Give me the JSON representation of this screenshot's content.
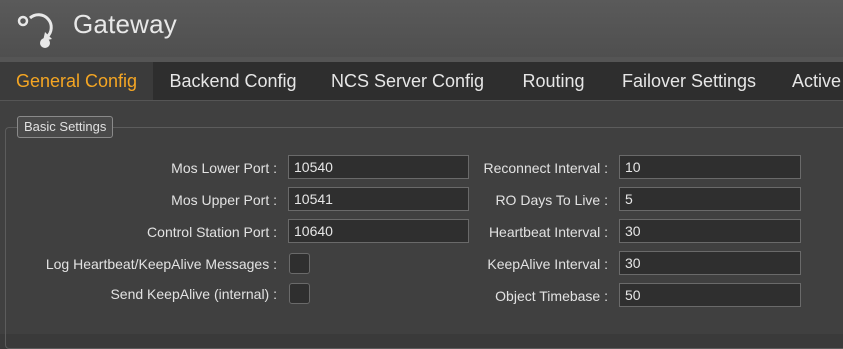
{
  "app": {
    "title": "Gateway",
    "logo_icon": "gateway-logo-icon"
  },
  "tabs": [
    {
      "label": "General Config",
      "active": true
    },
    {
      "label": "Backend Config",
      "active": false
    },
    {
      "label": "NCS Server Config",
      "active": false
    },
    {
      "label": "Routing",
      "active": false
    },
    {
      "label": "Failover Settings",
      "active": false
    },
    {
      "label": "Active",
      "active": false
    }
  ],
  "basic_settings": {
    "title": "Basic Settings",
    "left": {
      "mos_lower_port": {
        "label": "Mos Lower Port :",
        "value": "10540"
      },
      "mos_upper_port": {
        "label": "Mos Upper Port :",
        "value": "10541"
      },
      "control_station_port": {
        "label": "Control Station Port :",
        "value": "10640"
      },
      "log_heartbeat": {
        "label": "Log Heartbeat/KeepAlive Messages :",
        "checked": false
      },
      "send_keepalive": {
        "label": "Send KeepAlive (internal) :",
        "checked": false
      }
    },
    "right": {
      "reconnect_interval": {
        "label": "Reconnect Interval :",
        "value": "10"
      },
      "ro_days_to_live": {
        "label": "RO Days To Live :",
        "value": "5"
      },
      "heartbeat_interval": {
        "label": "Heartbeat Interval :",
        "value": "30"
      },
      "keepalive_interval": {
        "label": "KeepAlive Interval :",
        "value": "30"
      },
      "object_timebase": {
        "label": "Object Timebase :",
        "value": "50"
      }
    }
  },
  "colors": {
    "accent": "#f5a623",
    "background": "#404040",
    "header": "#555555",
    "tabbar": "#2e2e2e"
  }
}
